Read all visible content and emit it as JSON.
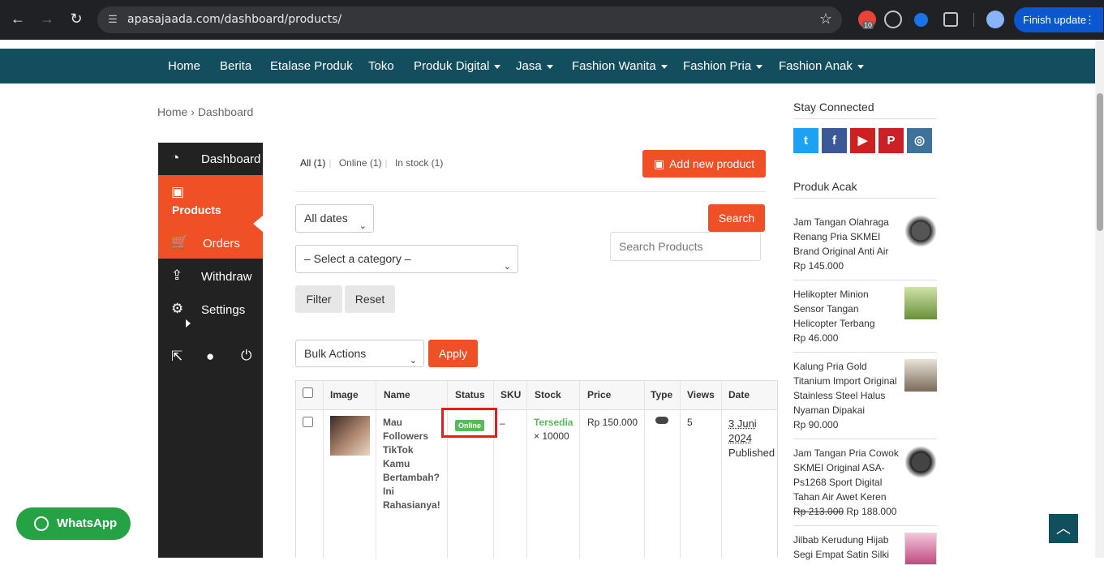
{
  "browser": {
    "url": "apasajaada.com/dashboard/products/",
    "finish_update": "Finish update",
    "notif_count": "10"
  },
  "nav": {
    "items": [
      {
        "label": "Home"
      },
      {
        "label": "Berita"
      },
      {
        "label": "Etalase Produk"
      },
      {
        "label": "Toko"
      },
      {
        "label": "Produk Digital"
      },
      {
        "label": "Jasa"
      },
      {
        "label": "Fashion Wanita"
      },
      {
        "label": "Fashion Pria"
      },
      {
        "label": "Fashion Anak"
      }
    ]
  },
  "breadcrumb": {
    "home": "Home",
    "sep": "›",
    "current": "Dashboard"
  },
  "sidebar": {
    "items": [
      {
        "label": "Dashboard",
        "icon": "gauge-icon"
      },
      {
        "label": "Products",
        "icon": "briefcase-icon"
      },
      {
        "label": "Orders",
        "icon": "cart-icon"
      },
      {
        "label": "Withdraw",
        "icon": "upload-icon"
      },
      {
        "label": "Settings",
        "icon": "gear-icon"
      }
    ]
  },
  "filters": {
    "all": "All (1)",
    "online": "Online (1)",
    "instock": "In stock (1)",
    "add_new": "Add new product",
    "dates": "All dates",
    "category": "– Select a category –",
    "search_btn": "Search",
    "search_placeholder": "Search Products",
    "filter_btn": "Filter",
    "reset_btn": "Reset",
    "bulk": "Bulk Actions",
    "apply": "Apply"
  },
  "table": {
    "headers": [
      "Image",
      "Name",
      "Status",
      "SKU",
      "Stock",
      "Price",
      "Type",
      "Views",
      "Date"
    ],
    "row": {
      "name": "Mau Followers TikTok Kamu Bertambah? Ini Rahasianya!",
      "status": "Online",
      "sku": "–",
      "stock_status": "Tersedia",
      "stock_qty": "× 10000",
      "price": "Rp 150.000",
      "views": "5",
      "date": "3 Juni 2024",
      "published": "Published"
    }
  },
  "widgets": {
    "stay_connected": "Stay Connected",
    "produk_acak": "Produk Acak",
    "products": [
      {
        "name": "Jam Tangan Olahraga Renang Pria SKMEI Brand Original Anti Air",
        "price": "Rp 145.000"
      },
      {
        "name": "Helikopter Minion Sensor Tangan Helicopter Terbang",
        "price": "Rp 46.000"
      },
      {
        "name": "Kalung Pria Gold Titanium Import Original Stainless Steel Halus Nyaman Dipakai",
        "price": "Rp 90.000"
      },
      {
        "name": "Jam Tangan Pria Cowok SKMEI Original ASA-Ps1268 Sport Digital Tahan Air Awet Keren",
        "old_price": "Rp 213.000",
        "price": "Rp 188.000"
      },
      {
        "name": "Jilbab Kerudung Hijab Segi Empat Satin Silki",
        "price": ""
      }
    ]
  },
  "whatsapp": "WhatsApp",
  "colors": {
    "accent": "#f05025",
    "nav": "#134e5e",
    "online": "#5cb85c",
    "highlight": "#e02020"
  }
}
